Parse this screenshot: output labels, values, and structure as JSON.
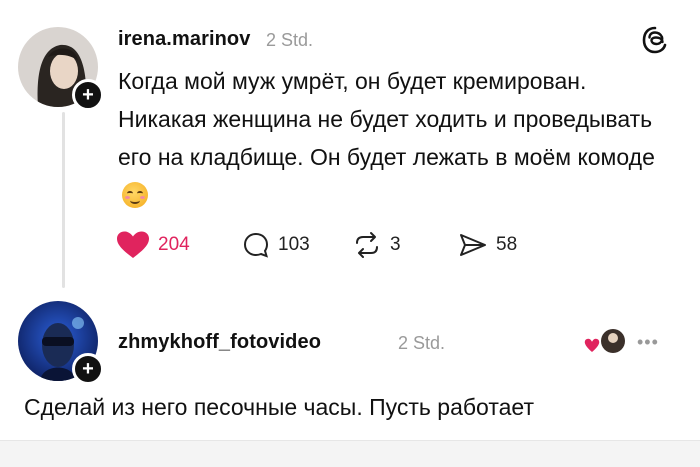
{
  "post": {
    "username": "irena.marinov",
    "time": "2 Std.",
    "text": "Когда мой муж умрёт, он будет кремирован. Никакая женщина не будет ходить и проведывать его на кладбище. Он будет лежать в моём комоде",
    "emoji": "smiling-face-with-blush-emoji",
    "stats": {
      "likes": "204",
      "comments": "103",
      "reposts": "3",
      "shares": "58"
    }
  },
  "reply": {
    "username": "zhmykhoff_fotovideo",
    "time": "2 Std.",
    "text": "Сделай из него песочные часы. Пусть работает"
  },
  "colors": {
    "like": "#e0245e",
    "text": "#111111",
    "muted": "#9a9a9a"
  }
}
